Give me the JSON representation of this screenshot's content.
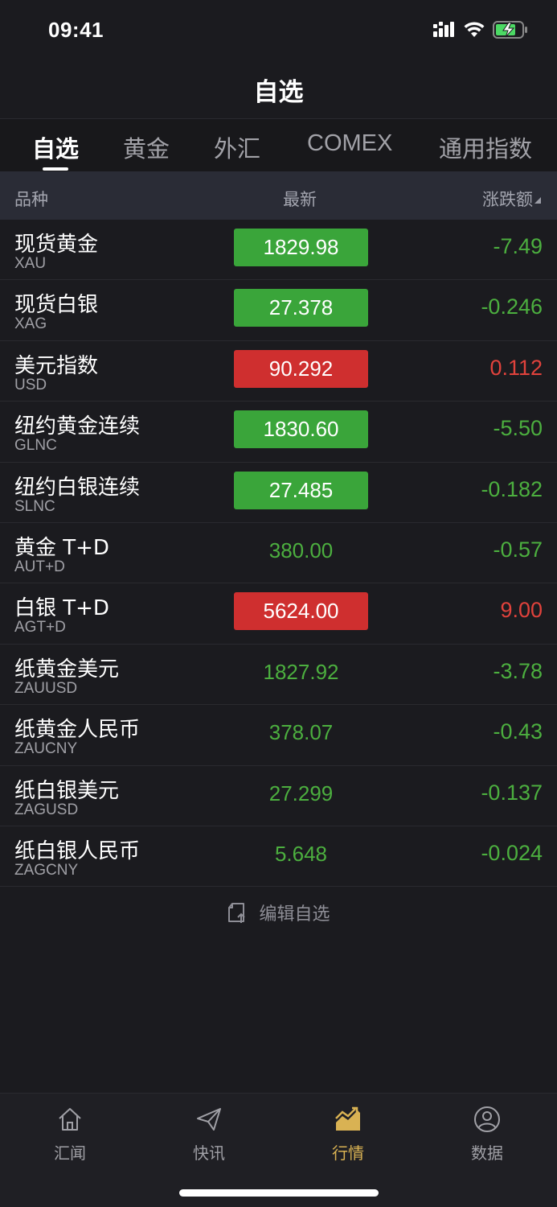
{
  "status_bar": {
    "time": "09:41"
  },
  "nav": {
    "title": "自选"
  },
  "tabs": [
    {
      "label": "自选"
    },
    {
      "label": "黄金"
    },
    {
      "label": "外汇"
    },
    {
      "label": "COMEX"
    },
    {
      "label": "通用指数"
    }
  ],
  "active_tab": "自选",
  "table_header": {
    "name": "品种",
    "last": "最新",
    "change": "涨跌额"
  },
  "rows": [
    {
      "name": "现货黄金",
      "code": "XAU",
      "price": "1829.98",
      "change": "-7.49",
      "direction": "down",
      "highlight": "green"
    },
    {
      "name": "现货白银",
      "code": "XAG",
      "price": "27.378",
      "change": "-0.246",
      "direction": "down",
      "highlight": "green"
    },
    {
      "name": "美元指数",
      "code": "USD",
      "price": "90.292",
      "change": "0.112",
      "direction": "up",
      "highlight": "red"
    },
    {
      "name": "纽约黄金连续",
      "code": "GLNC",
      "price": "1830.60",
      "change": "-5.50",
      "direction": "down",
      "highlight": "green"
    },
    {
      "name": "纽约白银连续",
      "code": "SLNC",
      "price": "27.485",
      "change": "-0.182",
      "direction": "down",
      "highlight": "green"
    },
    {
      "name": "黄金 T+D",
      "code": "AUT+D",
      "price": "380.00",
      "change": "-0.57",
      "direction": "down",
      "highlight": "none"
    },
    {
      "name": "白银 T+D",
      "code": "AGT+D",
      "price": "5624.00",
      "change": "9.00",
      "direction": "up",
      "highlight": "red"
    },
    {
      "name": "纸黄金美元",
      "code": "ZAUUSD",
      "price": "1827.92",
      "change": "-3.78",
      "direction": "down",
      "highlight": "none"
    },
    {
      "name": "纸黄金人民币",
      "code": "ZAUCNY",
      "price": "378.07",
      "change": "-0.43",
      "direction": "down",
      "highlight": "none"
    },
    {
      "name": "纸白银美元",
      "code": "ZAGUSD",
      "price": "27.299",
      "change": "-0.137",
      "direction": "down",
      "highlight": "none"
    },
    {
      "name": "纸白银人民币",
      "code": "ZAGCNY",
      "price": "5.648",
      "change": "-0.024",
      "direction": "down",
      "highlight": "none"
    }
  ],
  "edit": {
    "label": "编辑自选",
    "icon": "edit-list-icon"
  },
  "bottom_tabs": [
    {
      "label": "汇闻",
      "icon": "home-icon"
    },
    {
      "label": "快讯",
      "icon": "paper-plane-icon"
    },
    {
      "label": "行情",
      "icon": "market-chart-icon"
    },
    {
      "label": "数据",
      "icon": "user-circle-icon"
    }
  ],
  "active_bottom_tab": "行情",
  "colors": {
    "up": "#e0423c",
    "down": "#4caf3f",
    "up_box": "#cf2f2f",
    "down_box": "#3aa53a",
    "accent": "#d9b253",
    "background": "#1b1b1f"
  }
}
